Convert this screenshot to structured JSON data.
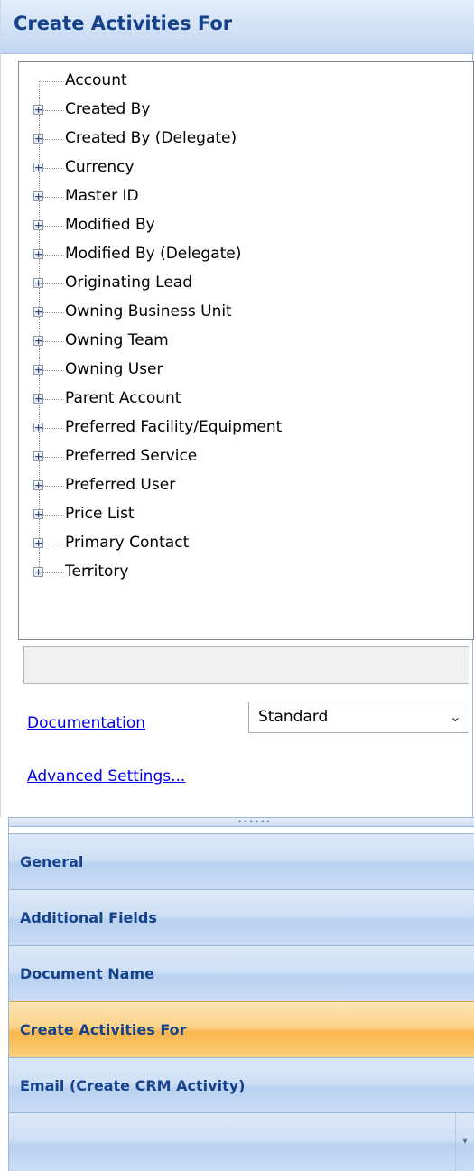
{
  "header": {
    "title": "Create Activities For"
  },
  "tree": {
    "items": [
      {
        "label": "Account",
        "expandable": false
      },
      {
        "label": "Created By",
        "expandable": true
      },
      {
        "label": "Created By (Delegate)",
        "expandable": true
      },
      {
        "label": "Currency",
        "expandable": true
      },
      {
        "label": "Master ID",
        "expandable": true
      },
      {
        "label": "Modified By",
        "expandable": true
      },
      {
        "label": "Modified By (Delegate)",
        "expandable": true
      },
      {
        "label": "Originating Lead",
        "expandable": true
      },
      {
        "label": "Owning Business Unit",
        "expandable": true
      },
      {
        "label": "Owning Team",
        "expandable": true
      },
      {
        "label": "Owning User",
        "expandable": true
      },
      {
        "label": "Parent Account",
        "expandable": true
      },
      {
        "label": "Preferred Facility/Equipment",
        "expandable": true
      },
      {
        "label": "Preferred Service",
        "expandable": true
      },
      {
        "label": "Preferred User",
        "expandable": true
      },
      {
        "label": "Price List",
        "expandable": true
      },
      {
        "label": "Primary Contact",
        "expandable": true
      },
      {
        "label": "Territory",
        "expandable": true
      }
    ]
  },
  "links": {
    "documentation": "Documentation",
    "advanced_settings": "Advanced Settings..."
  },
  "mode_select": {
    "value": "Standard"
  },
  "nav": {
    "items": [
      {
        "label": "General",
        "selected": false
      },
      {
        "label": "Additional Fields",
        "selected": false
      },
      {
        "label": "Document Name",
        "selected": false
      },
      {
        "label": "Create Activities For",
        "selected": true
      },
      {
        "label": "Email (Create CRM Activity)",
        "selected": false
      }
    ]
  },
  "colors": {
    "header_text": "#15428b",
    "link": "#0000ee",
    "selected_nav": "#f9b54b",
    "nav_blue": "#c9dcf5"
  }
}
